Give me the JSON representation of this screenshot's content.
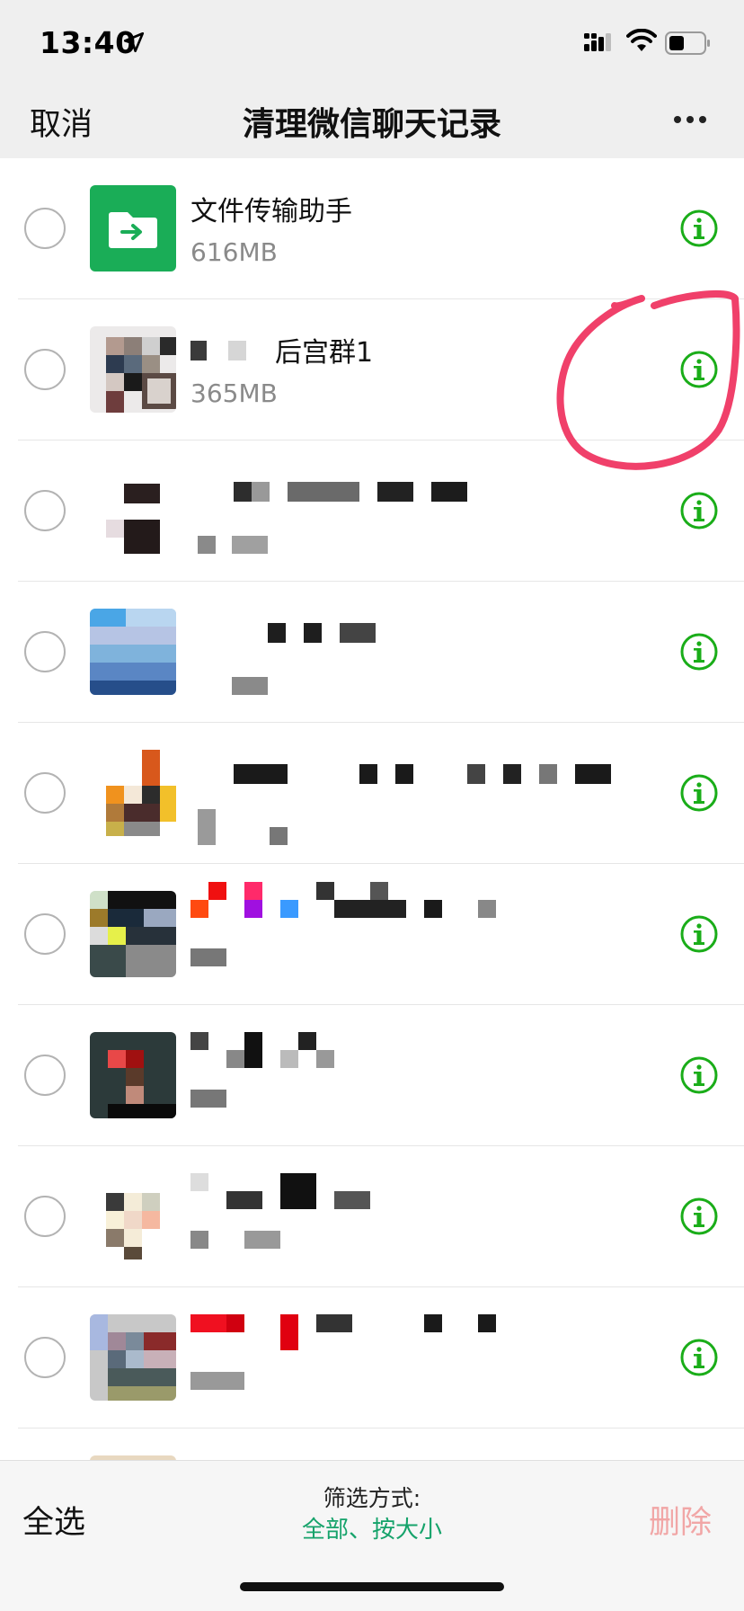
{
  "status_bar": {
    "time": "13:40"
  },
  "nav": {
    "cancel_label": "取消",
    "title": "清理微信聊天记录"
  },
  "chats": [
    {
      "name": "文件传输助手",
      "size": "616MB"
    },
    {
      "name": "后宫群1",
      "size": "365MB"
    }
  ],
  "bottom": {
    "select_all_label": "全选",
    "filter_label": "筛选方式:",
    "filter_value": "全部、按大小",
    "delete_label": "删除"
  },
  "colors": {
    "accent_green": "#1aad57",
    "info_green": "#1aad19",
    "annotation_red": "#f0406a",
    "delete_disabled": "#f1a6a6",
    "filter_green": "#16a36b"
  },
  "icons": [
    "location-arrow-icon",
    "signal-icon",
    "wifi-icon",
    "battery-icon",
    "more-icon",
    "file-transfer-icon",
    "info-icon"
  ]
}
